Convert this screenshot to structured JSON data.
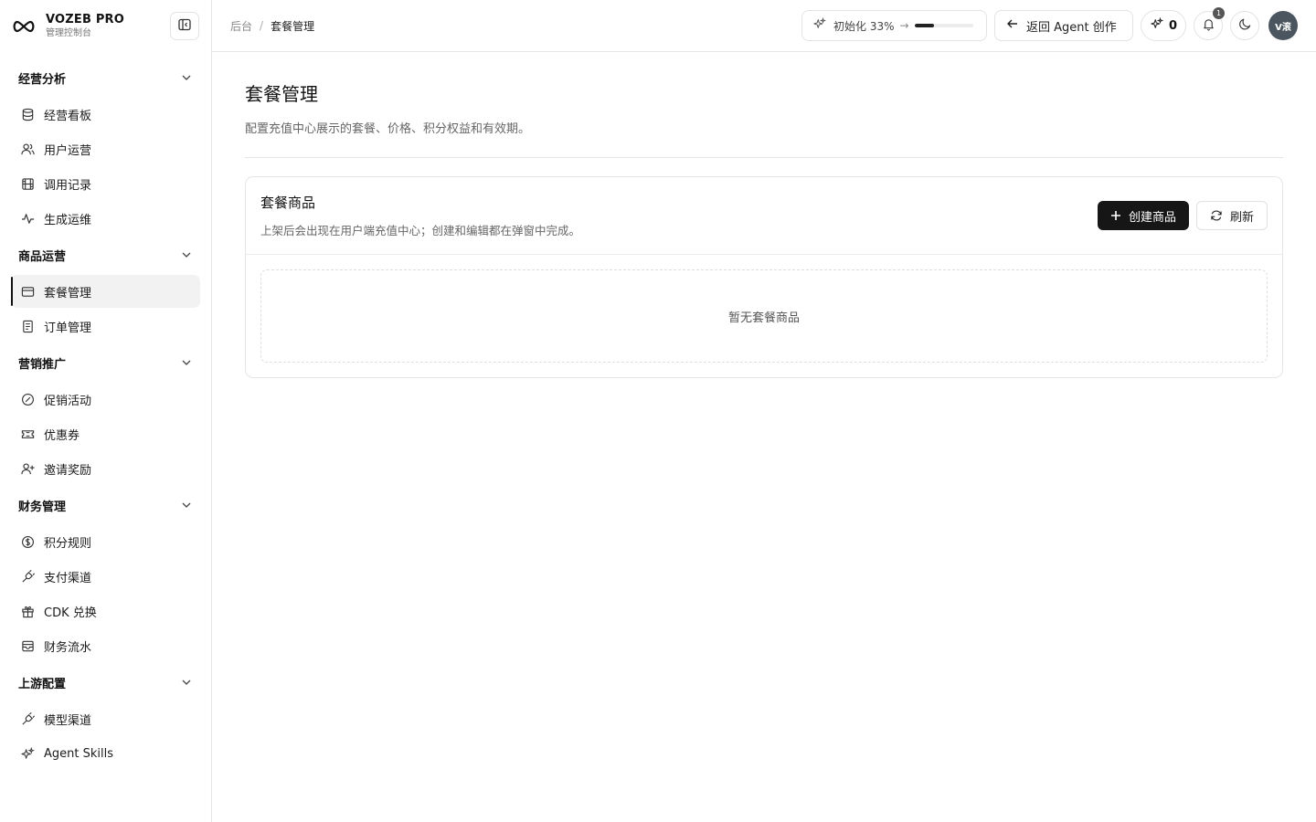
{
  "brand": {
    "title": "VOZEB PRO",
    "subtitle": "管理控制台"
  },
  "sidebar": {
    "groups": [
      {
        "label": "经营分析",
        "items": [
          {
            "label": "经营看板",
            "icon": "database-icon"
          },
          {
            "label": "用户运营",
            "icon": "users-icon"
          },
          {
            "label": "调用记录",
            "icon": "film-icon"
          },
          {
            "label": "生成运维",
            "icon": "activity-icon"
          }
        ]
      },
      {
        "label": "商品运营",
        "items": [
          {
            "label": "套餐管理",
            "icon": "card-icon",
            "active": true
          },
          {
            "label": "订单管理",
            "icon": "document-icon"
          }
        ]
      },
      {
        "label": "营销推广",
        "items": [
          {
            "label": "促销活动",
            "icon": "badge-percent-icon"
          },
          {
            "label": "优惠券",
            "icon": "ticket-icon"
          },
          {
            "label": "邀请奖励",
            "icon": "user-plus-icon"
          }
        ]
      },
      {
        "label": "财务管理",
        "items": [
          {
            "label": "积分规则",
            "icon": "dollar-circle-icon"
          },
          {
            "label": "支付渠道",
            "icon": "plug-icon"
          },
          {
            "label": "CDK 兑换",
            "icon": "gift-icon"
          },
          {
            "label": "财务流水",
            "icon": "wallet-icon"
          }
        ]
      },
      {
        "label": "上游配置",
        "items": [
          {
            "label": "模型渠道",
            "icon": "plug-icon"
          },
          {
            "label": "Agent Skills",
            "icon": "sparkles-icon"
          }
        ]
      }
    ]
  },
  "header": {
    "breadcrumb": {
      "root": "后台",
      "separator": "/",
      "current": "套餐管理"
    },
    "progress": {
      "label": "初始化 33%",
      "arrow": "→",
      "value": 0.33
    },
    "back_label": "返回 Agent 创作",
    "credits": "0",
    "notification_count": "1",
    "avatar_text": "V滚"
  },
  "page": {
    "title": "套餐管理",
    "description": "配置充值中心展示的套餐、价格、积分权益和有效期。"
  },
  "card": {
    "title": "套餐商品",
    "description": "上架后会出现在用户端充值中心；创建和编辑都在弹窗中完成。",
    "create_label": "创建商品",
    "refresh_label": "刷新",
    "empty_text": "暂无套餐商品"
  },
  "colors": {
    "accent": "#161616",
    "border": "#e5e5e5",
    "muted": "#666666"
  }
}
